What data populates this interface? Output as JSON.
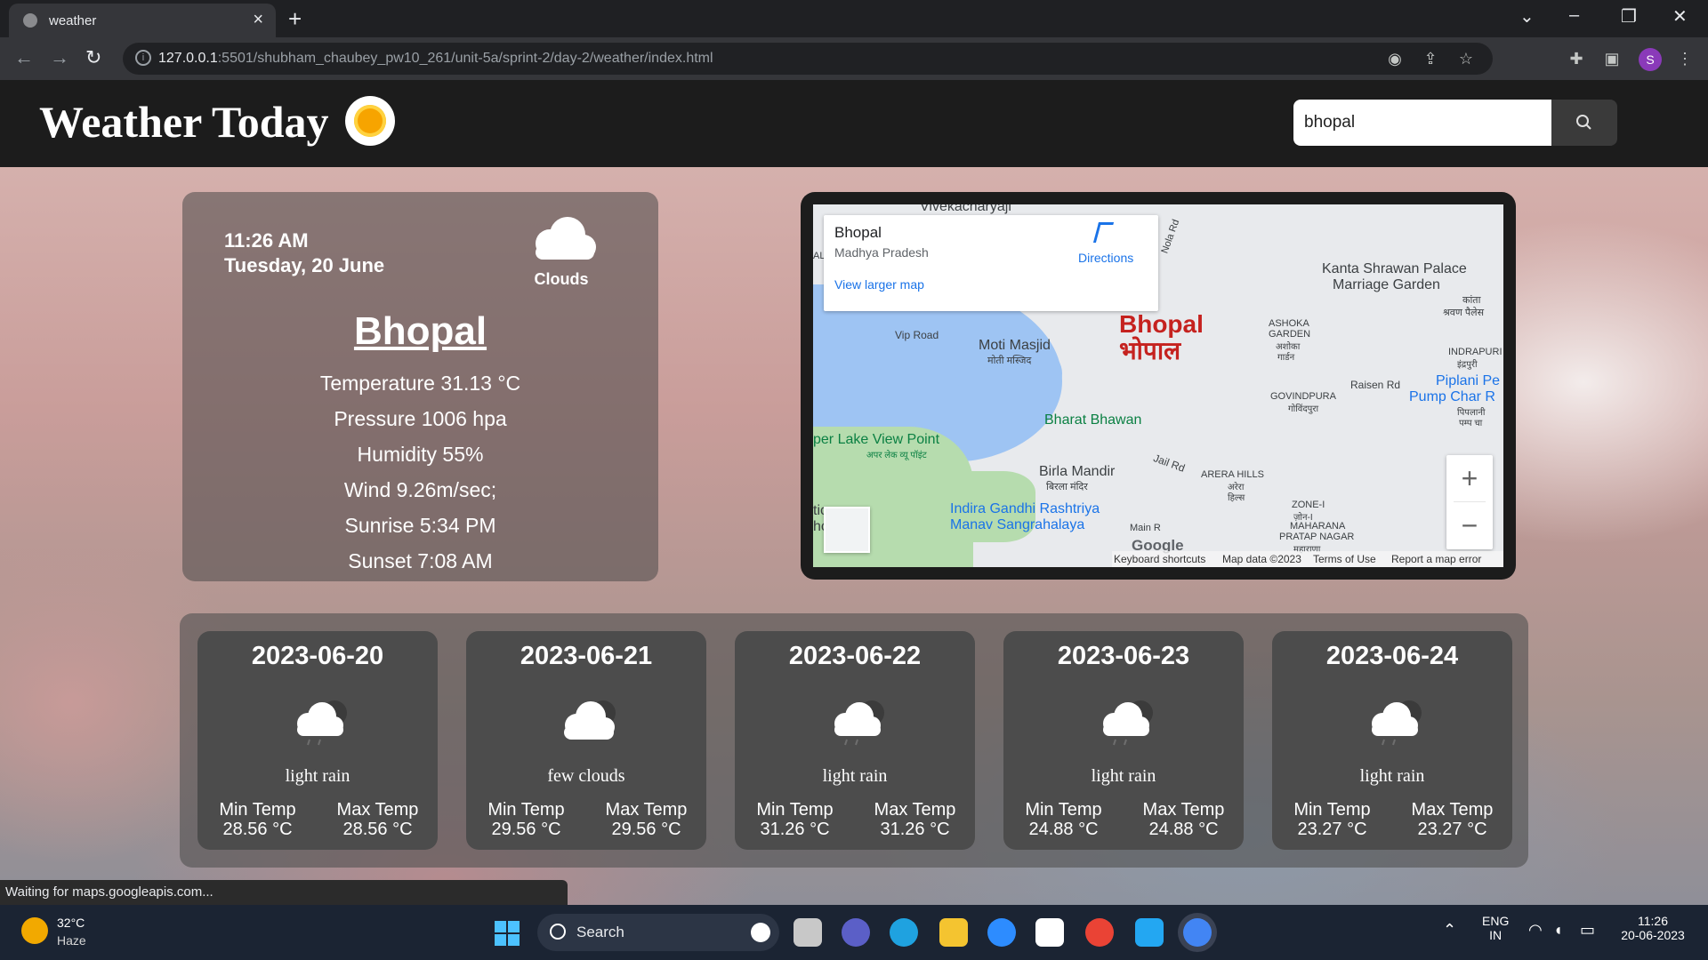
{
  "browser": {
    "tab_title": "weather",
    "url_host": "127.0.0.1",
    "url_rest": ":5501/shubham_chaubey_pw10_261/unit-5a/sprint-2/day-2/weather/index.html",
    "profile_initial": "S"
  },
  "header": {
    "brand": "Weather Today",
    "search_value": "bhopal"
  },
  "current": {
    "time": "11:26 AM",
    "date": "Tuesday, 20 June",
    "condition": "Clouds",
    "city": "Bhopal",
    "temperature": "Temperature 31.13 °C",
    "pressure": "Pressure 1006 hpa",
    "humidity": "Humidity 55%",
    "wind": "Wind 9.26m/sec;",
    "sunrise": "Sunrise 5:34 PM",
    "sunset": "Sunset 7:08 AM"
  },
  "map": {
    "place_name": "Bhopal",
    "place_region": "Madhya Pradesh",
    "directions": "Directions",
    "larger_map": "View larger map",
    "city_label": "Bhopal",
    "city_label_hindi": "भोपाल",
    "labels": {
      "vivekacharya": "Vivekacharyaji",
      "kanta": "Kanta Shrawan Palace",
      "marriage": "Marriage Garden",
      "kanta_hi": "कांता",
      "shravan_hi": "श्रवण पैलेस",
      "vip": "Vip Road",
      "moti": "Moti Masjid",
      "moti_hi": "मोती मस्जिद",
      "ashoka": "ASHOKA",
      "garden": "GARDEN",
      "ashoka_hi": "अशोका",
      "garden_hi": "गार्डन",
      "indrapuri": "INDRAPURI",
      "indrapuri_hi": "इंद्रपुरी",
      "piplani": "Piplani Pe",
      "pump": "Pump Char R",
      "piplani_hi": "पिपलानी",
      "pump_hi": "पम्प चा",
      "raisen": "Raisen Rd",
      "govindpura": "GOVINDPURA",
      "govindpura_hi": "गोविंदपुरा",
      "bharat": "Bharat Bhawan",
      "upper_lake": "per Lake View Point",
      "upper_lake_hi": "अपर लेक व्यू पॉइंट",
      "jail": "Jail Rd",
      "birla": "Birla Mandir",
      "birla_hi": "बिरला मंदिर",
      "arera": "ARERA HILLS",
      "arera_hi": "अरेरा",
      "hills_hi": "हिल्स",
      "zone": "ZONE-I",
      "zone_hi": "ज़ोन-I",
      "indira1": "Indira Gandhi Rashtriya",
      "indira2": "Manav Sangrahalaya",
      "maharana": "MAHARANA",
      "pratap": "PRATAP NAGAR",
      "maharana_hi": "महाराणा",
      "main": "Main R",
      "nola": "Nola Rd",
      "al": "AL",
      "tic": "tic",
      "hc": "hc"
    },
    "google": "Google",
    "attribution": [
      "Keyboard shortcuts",
      "Map data ©2023",
      "Terms of Use",
      "Report a map error"
    ],
    "zoom_in": "+",
    "zoom_out": "−"
  },
  "forecast": [
    {
      "date": "2023-06-20",
      "desc": "light rain",
      "min_label": "Min Temp",
      "max_label": "Max Temp",
      "min": "28.56 °C",
      "max": "28.56 °C"
    },
    {
      "date": "2023-06-21",
      "desc": "few clouds",
      "min_label": "Min Temp",
      "max_label": "Max Temp",
      "min": "29.56 °C",
      "max": "29.56 °C"
    },
    {
      "date": "2023-06-22",
      "desc": "light rain",
      "min_label": "Min Temp",
      "max_label": "Max Temp",
      "min": "31.26 °C",
      "max": "31.26 °C"
    },
    {
      "date": "2023-06-23",
      "desc": "light rain",
      "min_label": "Min Temp",
      "max_label": "Max Temp",
      "min": "24.88 °C",
      "max": "24.88 °C"
    },
    {
      "date": "2023-06-24",
      "desc": "light rain",
      "min_label": "Min Temp",
      "max_label": "Max Temp",
      "min": "23.27 °C",
      "max": "23.27 °C"
    }
  ],
  "status": "Waiting for maps.googleapis.com...",
  "taskbar": {
    "weather_temp": "32°C",
    "weather_cond": "Haze",
    "search_label": "Search",
    "lang1": "ENG",
    "lang2": "IN",
    "time": "11:26",
    "date": "20-06-2023"
  }
}
